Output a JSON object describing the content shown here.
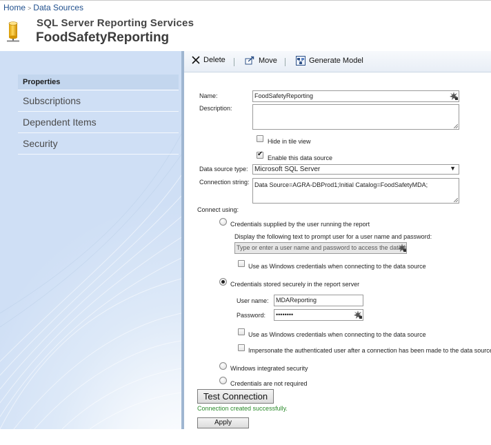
{
  "breadcrumb": {
    "home": "Home",
    "separator": ">",
    "current": "Data Sources"
  },
  "header": {
    "app_title": "SQL Server Reporting Services",
    "page_title": "FoodSafetyReporting"
  },
  "sidebar": {
    "items": [
      {
        "label": "Properties",
        "active": true
      },
      {
        "label": "Subscriptions",
        "active": false
      },
      {
        "label": "Dependent Items",
        "active": false
      },
      {
        "label": "Security",
        "active": false
      }
    ]
  },
  "toolbar": {
    "delete_label": "Delete",
    "move_label": "Move",
    "generate_model_label": "Generate Model"
  },
  "form": {
    "name_label": "Name:",
    "name_value": "FoodSafetyReporting",
    "description_label": "Description:",
    "description_value": "",
    "hide_in_tile_view_label": "Hide in tile view",
    "hide_in_tile_view_checked": false,
    "enable_label": "Enable this data source",
    "enable_checked": true,
    "data_source_type_label": "Data source type:",
    "data_source_type_value": "Microsoft SQL Server",
    "connection_string_label": "Connection string:",
    "connection_string_value": "Data Source=AGRA-DBProd1;Initial Catalog=FoodSafetyMDA;",
    "connect_using_label": "Connect using:",
    "credentials_prompt_label": "Credentials supplied by the user running the report",
    "prompt_text_label": "Display the following text to prompt user for a user name and password:",
    "prompt_text_value": "Type or enter a user name and password to access the data source",
    "prompt_windows_label": "Use as Windows credentials when connecting to the data source",
    "stored_label": "Credentials stored securely in the report server",
    "username_label": "User name:",
    "username_value": "MDAReporting",
    "password_label": "Password:",
    "password_value": "••••••••",
    "stored_windows_label": "Use as Windows credentials when connecting to the data source",
    "impersonate_label": "Impersonate the authenticated user after a connection has been made to the data source",
    "windows_integrated_label": "Windows integrated security",
    "not_required_label": "Credentials are not required",
    "selected_credential_option": "stored",
    "test_connection_label": "Test Connection",
    "status_message": "Connection created successfully.",
    "apply_label": "Apply"
  },
  "colors": {
    "link": "#1e4e8c",
    "status_ok": "#2a8a2a",
    "nav_active_bg": "#c3d6ee",
    "divider": "#9fb6d1"
  }
}
